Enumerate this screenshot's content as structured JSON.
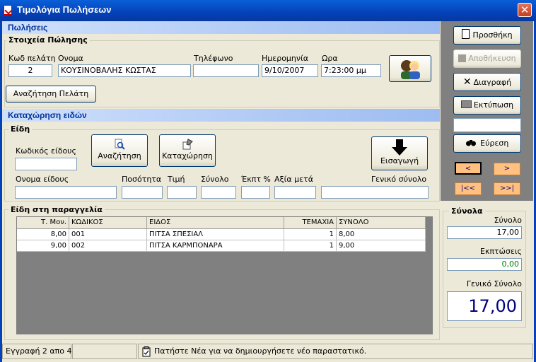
{
  "window": {
    "title": "Τιμολόγια Πωλήσεων",
    "close": "✕"
  },
  "sales": {
    "header": "Πωλήσεις",
    "customer_group": "Στοιχεία Πώλησης",
    "code_label": "Κωδ πελάτη",
    "name_label": "Ονομα",
    "phone_label": "Τηλέφωνο",
    "date_label": "Ημερομηνία",
    "time_label": "Ωρα",
    "code_value": "2",
    "name_value": "ΚΟΥΣΙΝΟΒΑΛΗΣ ΚΩΣΤΑΣ",
    "phone_value": "",
    "date_value": "9/10/2007",
    "time_value": "7:23:00 μμ",
    "search_customer": "Αναζήτηση Πελάτη"
  },
  "entry": {
    "header": "Καταχώρηση ειδών",
    "group": "Είδη",
    "item_code_label": "Κωδικός είδους",
    "search_btn": "Αναζήτηση",
    "register_btn": "Καταχώρηση",
    "insert_btn": "Εισαγωγή",
    "item_name_label": "Ονομα είδους",
    "qty_label": "Ποσότητα",
    "price_label": "Τιμή",
    "total_label": "Σύνολο",
    "discount_label": "Έκπτ %",
    "after_label": "Αξία μετά",
    "grand_label": "Γενικό σύνολο"
  },
  "order": {
    "group": "Είδη στη παραγγελία",
    "columns": [
      "Τ. Μον.",
      "ΚΩΔΙΚΟΣ",
      "ΕΙΔΟΣ",
      "ΤΕΜΑΧΙΑ",
      "ΣΥΝΟΛΟ"
    ],
    "rows": [
      [
        "8,00",
        "001",
        "ΠΙΤΣΑ ΣΠΕΣΙΑΛ",
        "1",
        "8,00"
      ],
      [
        "9,00",
        "002",
        "ΠΙΤΣΑ ΚΑΡΜΠΟΝΑΡΑ",
        "1",
        "9,00"
      ]
    ]
  },
  "actions": {
    "new": "Προσθήκη",
    "save": "Αποθήκευση",
    "delete": "Διαγραφή",
    "print": "Εκτύπωση",
    "find": "Εύρεση",
    "find_value": "",
    "prev": "<",
    "next": ">",
    "first": "|<<",
    "last": ">>|"
  },
  "totals": {
    "group": "Σύνολα",
    "sum_label": "Σύνολο",
    "sum_value": "17,00",
    "discount_label": "Εκπτώσεις",
    "discount_value": "0,00",
    "grand_label": "Γενικό Σύνολο",
    "grand_value": "17,00"
  },
  "status": {
    "record": "Εγγραφή 2 απο 4",
    "middle": "",
    "hint": "Πατήστε Νέα για να δημιουργήσετε νέο παραστατικό."
  },
  "colors": {
    "title_bar": "#0442b8",
    "section": "#9dbcf1",
    "nav": "#ffc080",
    "grand_total": "#000080",
    "discount": "#008000"
  }
}
